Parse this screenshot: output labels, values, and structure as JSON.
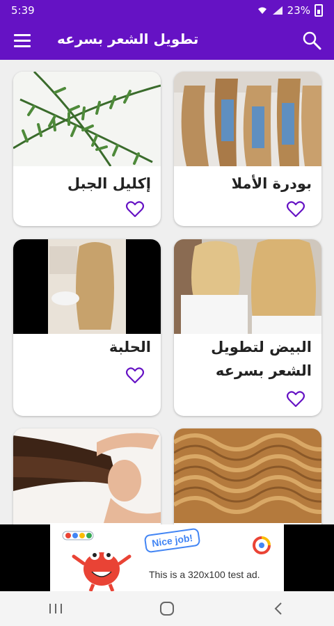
{
  "status_bar": {
    "time": "5:39",
    "battery": "23%"
  },
  "app_bar": {
    "title": "تطويل الشعر بسرعه"
  },
  "cards": [
    {
      "label": "بودرة الأملا"
    },
    {
      "label": "إكليل الجبل"
    },
    {
      "label": "البيض لتطويل الشعر بسرعه"
    },
    {
      "label": "الحلبة"
    },
    {
      "label": ""
    },
    {
      "label": ""
    }
  ],
  "ad": {
    "badge": "Nice job!",
    "text": "This is a 320x100 test ad."
  },
  "colors": {
    "primary": "#6512c4",
    "heart": "#6512c4"
  }
}
